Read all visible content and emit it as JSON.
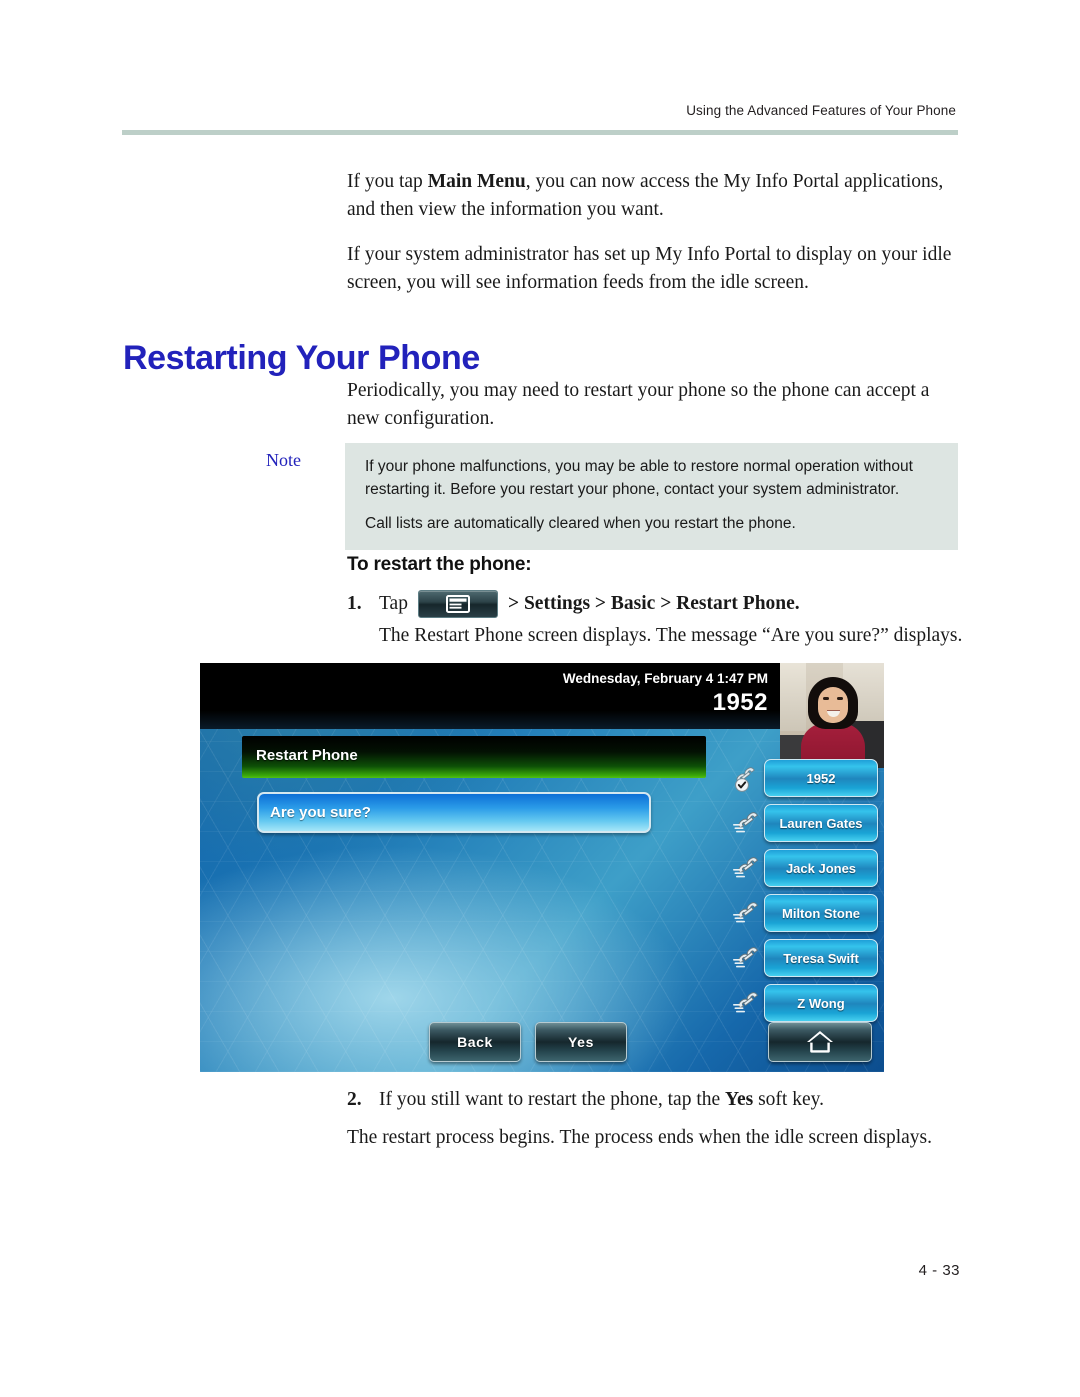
{
  "page": {
    "running_header": "Using the Advanced Features of Your Phone",
    "page_number": "4 - 33",
    "rule_color": "#bdcfc8",
    "heading_color": "#2222bb"
  },
  "intro": {
    "para1_before_bold": "If you tap ",
    "para1_bold": "Main Menu",
    "para1_after_bold": ", you can now access the My Info Portal applications, and then view the information you want.",
    "para2": "If your system administrator has set up My Info Portal to display on your idle screen, you will see information feeds from the idle screen."
  },
  "section": {
    "heading": "Restarting Your Phone",
    "intro": "Periodically, you may need to restart your phone so the phone can accept a new configuration."
  },
  "note": {
    "label": "Note",
    "line1": "If your phone malfunctions, you may be able to restore normal operation without restarting it. Before you restart your phone, contact your system administrator.",
    "line2": "Call lists are automatically cleared when you restart the phone.",
    "background": "#dde5e2"
  },
  "procedure": {
    "title": "To restart the phone:",
    "steps": [
      {
        "number": "1.",
        "text_before_icon": "Tap",
        "icon": "main-menu-icon",
        "text_after_icon": "> Settings > Basic > Restart Phone.",
        "detail": "The Restart Phone screen displays. The message “Are you sure?” displays."
      },
      {
        "number": "2.",
        "text_plain_before": "If you still want to restart the phone, tap the ",
        "text_bold": "Yes",
        "text_plain_after": " soft key.",
        "detail": "The restart process begins. The process ends when the idle screen displays."
      }
    ]
  },
  "phone_screen": {
    "status_datetime": "Wednesday, February 4  1:47 PM",
    "status_extension": "1952",
    "title_bar": "Restart Phone",
    "prompt": "Are you sure?",
    "line_keys": [
      {
        "label": "1952",
        "icon": "handset-registered-icon"
      },
      {
        "label": "Lauren Gates",
        "icon": "handset-icon"
      },
      {
        "label": "Jack Jones",
        "icon": "handset-icon"
      },
      {
        "label": "Milton Stone",
        "icon": "handset-icon"
      },
      {
        "label": "Teresa Swift",
        "icon": "handset-icon"
      },
      {
        "label": "Z Wong",
        "icon": "handset-icon"
      }
    ],
    "soft_keys": [
      {
        "label": "Back",
        "icon": ""
      },
      {
        "label": "Yes",
        "icon": ""
      },
      {
        "label": "",
        "icon": "home-icon"
      }
    ]
  }
}
